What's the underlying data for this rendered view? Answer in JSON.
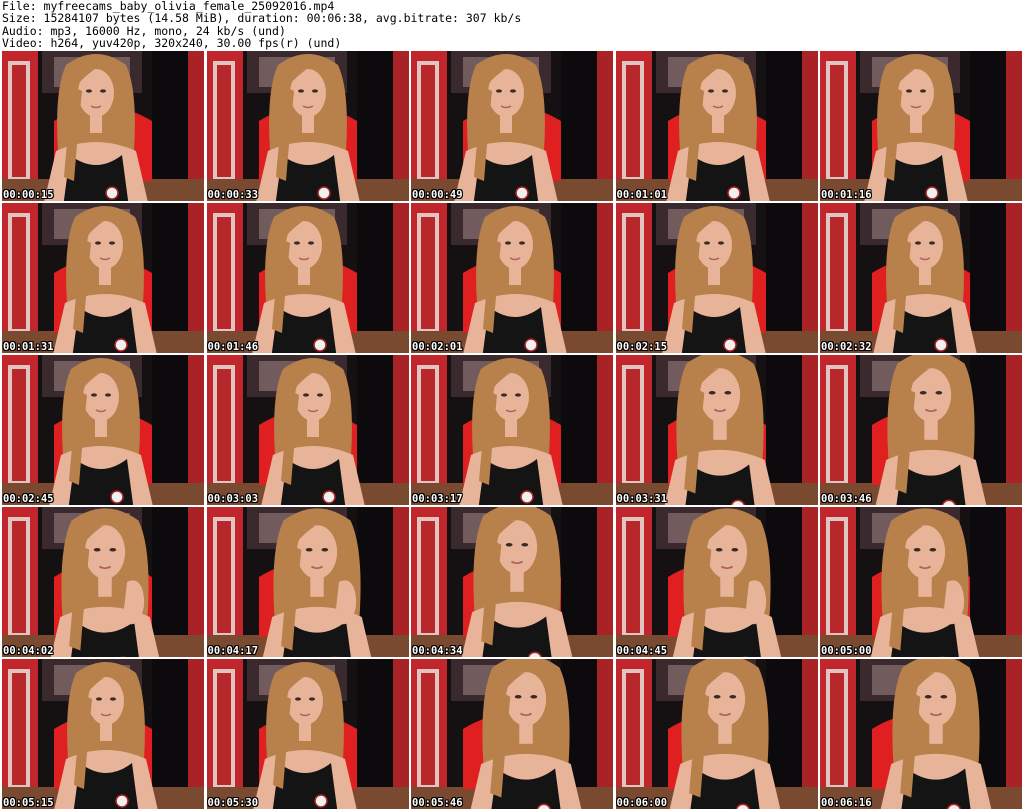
{
  "header": {
    "file": "File: myfreecams_baby_olivia_female_25092016.mp4",
    "size": "Size: 15284107 bytes (14.58 MiB), duration: 00:06:38, avg.bitrate: 307 kb/s",
    "audio": "Audio: mp3, 16000 Hz, mono, 24 kb/s (und)",
    "video": "Video: h264, yuv420p, 320x240, 30.00 fps(r) (und)"
  },
  "thumbnails": [
    {
      "time": "00:00:15",
      "pose": "center"
    },
    {
      "time": "00:00:33",
      "pose": "center"
    },
    {
      "time": "00:00:49",
      "pose": "center"
    },
    {
      "time": "00:01:01",
      "pose": "center"
    },
    {
      "time": "00:01:16",
      "pose": "center"
    },
    {
      "time": "00:01:31",
      "pose": "center"
    },
    {
      "time": "00:01:46",
      "pose": "center"
    },
    {
      "time": "00:02:01",
      "pose": "center"
    },
    {
      "time": "00:02:15",
      "pose": "center"
    },
    {
      "time": "00:02:32",
      "pose": "center"
    },
    {
      "time": "00:02:45",
      "pose": "center"
    },
    {
      "time": "00:03:03",
      "pose": "center"
    },
    {
      "time": "00:03:17",
      "pose": "center"
    },
    {
      "time": "00:03:31",
      "pose": "close"
    },
    {
      "time": "00:03:46",
      "pose": "close"
    },
    {
      "time": "00:04:02",
      "pose": "hand"
    },
    {
      "time": "00:04:17",
      "pose": "hand"
    },
    {
      "time": "00:04:34",
      "pose": "close"
    },
    {
      "time": "00:04:45",
      "pose": "hand"
    },
    {
      "time": "00:05:00",
      "pose": "hand"
    },
    {
      "time": "00:05:15",
      "pose": "center"
    },
    {
      "time": "00:05:30",
      "pose": "center"
    },
    {
      "time": "00:05:46",
      "pose": "close"
    },
    {
      "time": "00:06:00",
      "pose": "close"
    },
    {
      "time": "00:06:16",
      "pose": "close"
    }
  ],
  "colors": {
    "wall_red": "#c0262c",
    "chair_red": "#e02020",
    "curtain": "#151012",
    "skin": "#e7b49a",
    "hair": "#b8804a",
    "top": "#141414",
    "floor": "#7a4a30"
  }
}
